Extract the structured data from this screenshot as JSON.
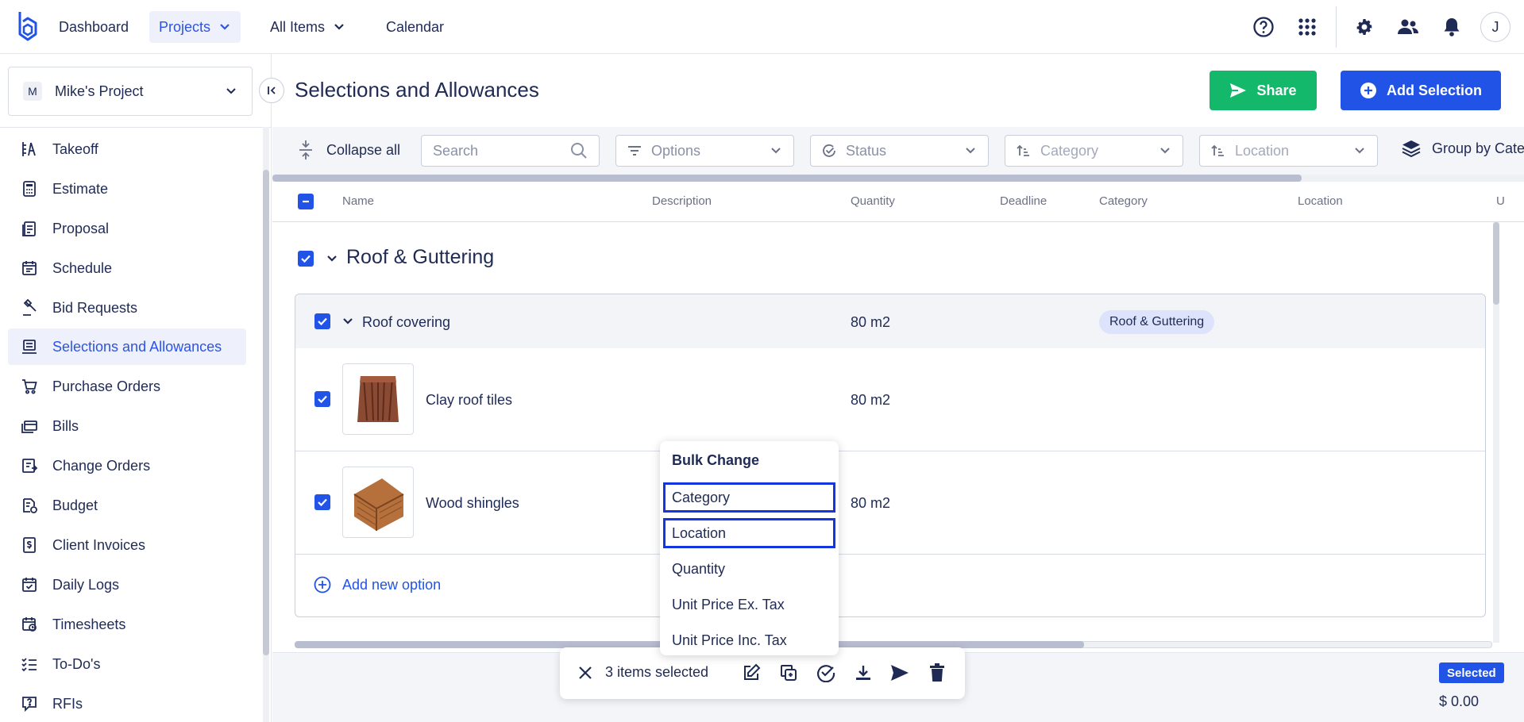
{
  "topnav": {
    "items": [
      {
        "label": "Dashboard"
      },
      {
        "label": "Projects"
      },
      {
        "label": "All Items"
      },
      {
        "label": "Calendar"
      }
    ],
    "avatar": "J"
  },
  "sidebar": {
    "project_badge": "M",
    "project_name": "Mike's Project",
    "items": [
      {
        "label": "Takeoff",
        "icon": "takeoff-icon"
      },
      {
        "label": "Estimate",
        "icon": "calculator-icon"
      },
      {
        "label": "Proposal",
        "icon": "proposal-icon"
      },
      {
        "label": "Schedule",
        "icon": "calendar-icon"
      },
      {
        "label": "Bid Requests",
        "icon": "gavel-icon"
      },
      {
        "label": "Selections and Allowances",
        "icon": "selections-icon"
      },
      {
        "label": "Purchase Orders",
        "icon": "cart-icon"
      },
      {
        "label": "Bills",
        "icon": "bills-icon"
      },
      {
        "label": "Change Orders",
        "icon": "change-orders-icon"
      },
      {
        "label": "Budget",
        "icon": "budget-icon"
      },
      {
        "label": "Client Invoices",
        "icon": "invoice-icon"
      },
      {
        "label": "Daily Logs",
        "icon": "daily-log-icon"
      },
      {
        "label": "Timesheets",
        "icon": "timesheet-icon"
      },
      {
        "label": "To-Do's",
        "icon": "todo-icon"
      },
      {
        "label": "RFIs",
        "icon": "rfi-icon"
      }
    ]
  },
  "page": {
    "title": "Selections and Allowances",
    "share_label": "Share",
    "add_label": "Add Selection"
  },
  "toolbar": {
    "collapse_all": "Collapse all",
    "search_placeholder": "Search",
    "options": "Options",
    "status": "Status",
    "category": "Category",
    "location": "Location",
    "group_by": "Group by Cate"
  },
  "table": {
    "headers": [
      "Name",
      "Description",
      "Quantity",
      "Deadline",
      "Category",
      "Location",
      "U"
    ],
    "group_title": "Roof & Guttering",
    "parent_row": {
      "name": "Roof covering",
      "quantity": "80 m2",
      "category": "Roof & Guttering"
    },
    "options": [
      {
        "name": "Clay roof tiles",
        "quantity": "80 m2"
      },
      {
        "name": "Wood shingles",
        "quantity": "80 m2"
      }
    ],
    "add_option": "Add new option"
  },
  "footer": {
    "selected_badge": "Selected",
    "amount": "$ 0.00"
  },
  "bulk_bar": {
    "count_text": "3 items selected"
  },
  "bulk_menu": {
    "title": "Bulk Change",
    "options": [
      "Category",
      "Location",
      "Quantity",
      "Unit Price Ex. Tax",
      "Unit Price Inc. Tax"
    ]
  },
  "colors": {
    "primary": "#2153e6",
    "share_green": "#13b86a",
    "text_dark": "#1f2a55",
    "highlight_border": "#1436e0"
  }
}
